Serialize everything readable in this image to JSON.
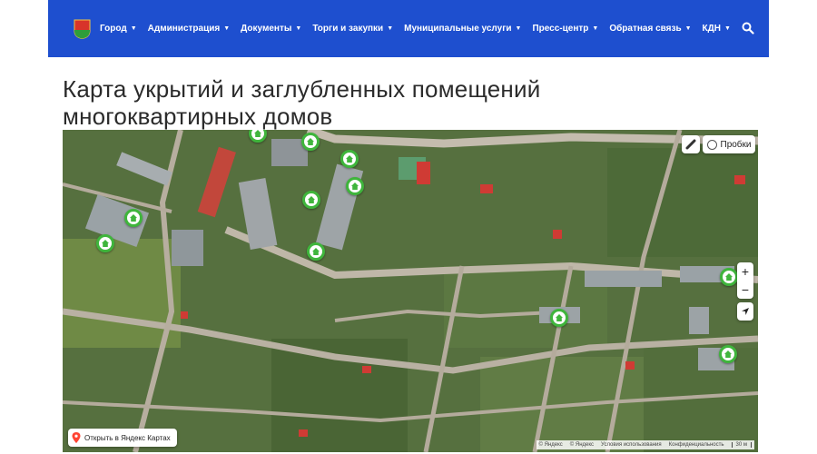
{
  "navbar": {
    "bg_color": "#1e4fcf",
    "items": [
      {
        "label": "Город"
      },
      {
        "label": "Администрация"
      },
      {
        "label": "Документы"
      },
      {
        "label": "Торги и закупки"
      },
      {
        "label": "Муниципальные услуги"
      },
      {
        "label": "Пресс-центр"
      },
      {
        "label": "Обратная связь"
      },
      {
        "label": "КДН"
      }
    ],
    "search_icon": "search-icon",
    "logo_icon": "coat-of-arms-icon"
  },
  "page": {
    "title": "Карта укрытий и заглубленных помещений многоквартирных домов"
  },
  "map": {
    "traffic_label": "Пробки",
    "zoom_in": "+",
    "zoom_out": "−",
    "open_link_label": "Открыть в Яндекс Картах",
    "copyright": {
      "yandex1": "© Яндекс",
      "yandex2": "© Яндекс",
      "terms": "Условия использования",
      "privacy": "Конфиденциальность",
      "scale": "30 м"
    },
    "marker_color": "#3fb53c",
    "marker_count": 14
  }
}
